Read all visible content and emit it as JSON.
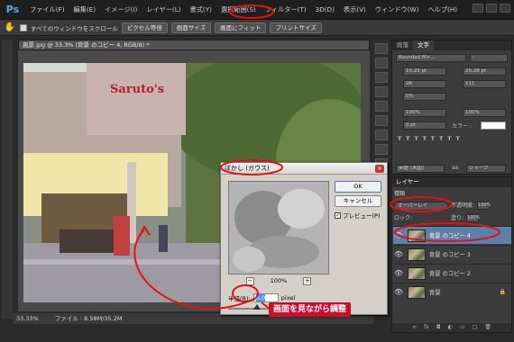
{
  "app": {
    "logo": "Ps"
  },
  "menu": [
    "ファイル(F)",
    "編集(E)",
    "イメージ(I)",
    "レイヤー(L)",
    "書式(Y)",
    "選択範囲(S)",
    "フィルター(T)",
    "3D(D)",
    "表示(V)",
    "ウィンドウ(W)",
    "ヘルプ(H)"
  ],
  "options": {
    "scroll_all": "すべてのウィンドウをスクロール",
    "buttons": [
      "ピクセル等倍",
      "画面サイズ",
      "画面にフィット",
      "プリントサイズ"
    ]
  },
  "document": {
    "tab_title": "風景.jpg @ 33.3% (背景 のコピー 4, RGB/8) *",
    "zoom": "33.33%",
    "file_info": "ファイル : 8.58M/35.2M",
    "sign_text": "Saruto's"
  },
  "char_panel": {
    "tabs": [
      "段落",
      "文字"
    ],
    "font": "Rounded M+...",
    "style": "-",
    "size": "10.25 pt",
    "leading": "20.28 pt",
    "tracking": "VA",
    "kerning": "111",
    "scale": "0%",
    "v_scale": "100%",
    "h_scale": "100%",
    "baseline": "0 pt",
    "color_label": "カラー :",
    "lang": "英語 (米国)",
    "aa": "シャープ",
    "aa_icon": "aa"
  },
  "layers": {
    "title": "レイヤー",
    "filter_label": "種類",
    "blend_mode": "オーバーレイ",
    "opacity_label": "不透明度:",
    "opacity": "100%",
    "lock_label": "ロック:",
    "fill_label": "塗り:",
    "fill": "100%",
    "items": [
      {
        "name": "背景 のコピー 4",
        "selected": true
      },
      {
        "name": "背景 のコピー 3",
        "selected": false
      },
      {
        "name": "背景 のコピー 2",
        "selected": false
      },
      {
        "name": "背景",
        "selected": false,
        "locked": true
      }
    ]
  },
  "dialog": {
    "title": "ぼかし (ガウス)",
    "ok": "OK",
    "cancel": "キャンセル",
    "preview_label": "プレビュー(P)",
    "preview_checked": true,
    "zoom": "100%",
    "radius_label": "半径(R):",
    "radius_value": "6.0",
    "radius_unit": "pixel"
  },
  "annotation": {
    "callout": "画面を見ながら調整"
  },
  "colors": {
    "accent_red": "#e81010",
    "selection_blue": "#5d7fa8"
  }
}
